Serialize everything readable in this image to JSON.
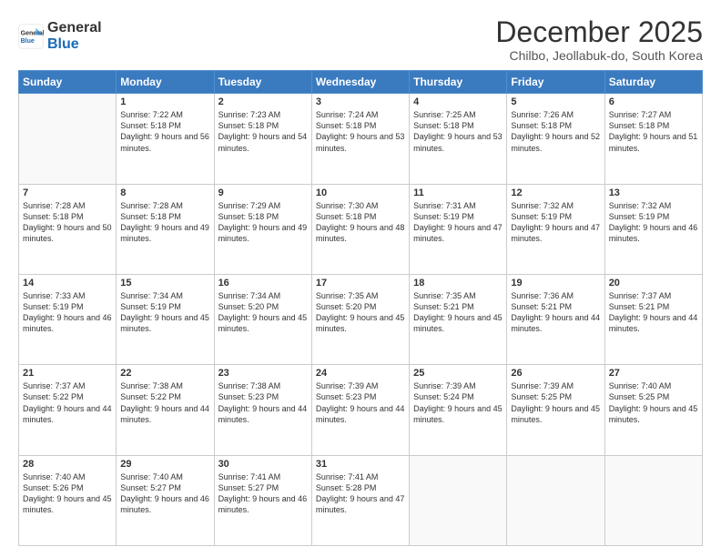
{
  "logo": {
    "general": "General",
    "blue": "Blue"
  },
  "header": {
    "month": "December 2025",
    "location": "Chilbo, Jeollabuk-do, South Korea"
  },
  "days_of_week": [
    "Sunday",
    "Monday",
    "Tuesday",
    "Wednesday",
    "Thursday",
    "Friday",
    "Saturday"
  ],
  "weeks": [
    [
      {
        "day": "",
        "sunrise": "",
        "sunset": "",
        "daylight": ""
      },
      {
        "day": "1",
        "sunrise": "Sunrise: 7:22 AM",
        "sunset": "Sunset: 5:18 PM",
        "daylight": "Daylight: 9 hours and 56 minutes."
      },
      {
        "day": "2",
        "sunrise": "Sunrise: 7:23 AM",
        "sunset": "Sunset: 5:18 PM",
        "daylight": "Daylight: 9 hours and 54 minutes."
      },
      {
        "day": "3",
        "sunrise": "Sunrise: 7:24 AM",
        "sunset": "Sunset: 5:18 PM",
        "daylight": "Daylight: 9 hours and 53 minutes."
      },
      {
        "day": "4",
        "sunrise": "Sunrise: 7:25 AM",
        "sunset": "Sunset: 5:18 PM",
        "daylight": "Daylight: 9 hours and 53 minutes."
      },
      {
        "day": "5",
        "sunrise": "Sunrise: 7:26 AM",
        "sunset": "Sunset: 5:18 PM",
        "daylight": "Daylight: 9 hours and 52 minutes."
      },
      {
        "day": "6",
        "sunrise": "Sunrise: 7:27 AM",
        "sunset": "Sunset: 5:18 PM",
        "daylight": "Daylight: 9 hours and 51 minutes."
      }
    ],
    [
      {
        "day": "7",
        "sunrise": "Sunrise: 7:28 AM",
        "sunset": "Sunset: 5:18 PM",
        "daylight": "Daylight: 9 hours and 50 minutes."
      },
      {
        "day": "8",
        "sunrise": "Sunrise: 7:28 AM",
        "sunset": "Sunset: 5:18 PM",
        "daylight": "Daylight: 9 hours and 49 minutes."
      },
      {
        "day": "9",
        "sunrise": "Sunrise: 7:29 AM",
        "sunset": "Sunset: 5:18 PM",
        "daylight": "Daylight: 9 hours and 49 minutes."
      },
      {
        "day": "10",
        "sunrise": "Sunrise: 7:30 AM",
        "sunset": "Sunset: 5:18 PM",
        "daylight": "Daylight: 9 hours and 48 minutes."
      },
      {
        "day": "11",
        "sunrise": "Sunrise: 7:31 AM",
        "sunset": "Sunset: 5:19 PM",
        "daylight": "Daylight: 9 hours and 47 minutes."
      },
      {
        "day": "12",
        "sunrise": "Sunrise: 7:32 AM",
        "sunset": "Sunset: 5:19 PM",
        "daylight": "Daylight: 9 hours and 47 minutes."
      },
      {
        "day": "13",
        "sunrise": "Sunrise: 7:32 AM",
        "sunset": "Sunset: 5:19 PM",
        "daylight": "Daylight: 9 hours and 46 minutes."
      }
    ],
    [
      {
        "day": "14",
        "sunrise": "Sunrise: 7:33 AM",
        "sunset": "Sunset: 5:19 PM",
        "daylight": "Daylight: 9 hours and 46 minutes."
      },
      {
        "day": "15",
        "sunrise": "Sunrise: 7:34 AM",
        "sunset": "Sunset: 5:19 PM",
        "daylight": "Daylight: 9 hours and 45 minutes."
      },
      {
        "day": "16",
        "sunrise": "Sunrise: 7:34 AM",
        "sunset": "Sunset: 5:20 PM",
        "daylight": "Daylight: 9 hours and 45 minutes."
      },
      {
        "day": "17",
        "sunrise": "Sunrise: 7:35 AM",
        "sunset": "Sunset: 5:20 PM",
        "daylight": "Daylight: 9 hours and 45 minutes."
      },
      {
        "day": "18",
        "sunrise": "Sunrise: 7:35 AM",
        "sunset": "Sunset: 5:21 PM",
        "daylight": "Daylight: 9 hours and 45 minutes."
      },
      {
        "day": "19",
        "sunrise": "Sunrise: 7:36 AM",
        "sunset": "Sunset: 5:21 PM",
        "daylight": "Daylight: 9 hours and 44 minutes."
      },
      {
        "day": "20",
        "sunrise": "Sunrise: 7:37 AM",
        "sunset": "Sunset: 5:21 PM",
        "daylight": "Daylight: 9 hours and 44 minutes."
      }
    ],
    [
      {
        "day": "21",
        "sunrise": "Sunrise: 7:37 AM",
        "sunset": "Sunset: 5:22 PM",
        "daylight": "Daylight: 9 hours and 44 minutes."
      },
      {
        "day": "22",
        "sunrise": "Sunrise: 7:38 AM",
        "sunset": "Sunset: 5:22 PM",
        "daylight": "Daylight: 9 hours and 44 minutes."
      },
      {
        "day": "23",
        "sunrise": "Sunrise: 7:38 AM",
        "sunset": "Sunset: 5:23 PM",
        "daylight": "Daylight: 9 hours and 44 minutes."
      },
      {
        "day": "24",
        "sunrise": "Sunrise: 7:39 AM",
        "sunset": "Sunset: 5:23 PM",
        "daylight": "Daylight: 9 hours and 44 minutes."
      },
      {
        "day": "25",
        "sunrise": "Sunrise: 7:39 AM",
        "sunset": "Sunset: 5:24 PM",
        "daylight": "Daylight: 9 hours and 45 minutes."
      },
      {
        "day": "26",
        "sunrise": "Sunrise: 7:39 AM",
        "sunset": "Sunset: 5:25 PM",
        "daylight": "Daylight: 9 hours and 45 minutes."
      },
      {
        "day": "27",
        "sunrise": "Sunrise: 7:40 AM",
        "sunset": "Sunset: 5:25 PM",
        "daylight": "Daylight: 9 hours and 45 minutes."
      }
    ],
    [
      {
        "day": "28",
        "sunrise": "Sunrise: 7:40 AM",
        "sunset": "Sunset: 5:26 PM",
        "daylight": "Daylight: 9 hours and 45 minutes."
      },
      {
        "day": "29",
        "sunrise": "Sunrise: 7:40 AM",
        "sunset": "Sunset: 5:27 PM",
        "daylight": "Daylight: 9 hours and 46 minutes."
      },
      {
        "day": "30",
        "sunrise": "Sunrise: 7:41 AM",
        "sunset": "Sunset: 5:27 PM",
        "daylight": "Daylight: 9 hours and 46 minutes."
      },
      {
        "day": "31",
        "sunrise": "Sunrise: 7:41 AM",
        "sunset": "Sunset: 5:28 PM",
        "daylight": "Daylight: 9 hours and 47 minutes."
      },
      {
        "day": "",
        "sunrise": "",
        "sunset": "",
        "daylight": ""
      },
      {
        "day": "",
        "sunrise": "",
        "sunset": "",
        "daylight": ""
      },
      {
        "day": "",
        "sunrise": "",
        "sunset": "",
        "daylight": ""
      }
    ]
  ]
}
